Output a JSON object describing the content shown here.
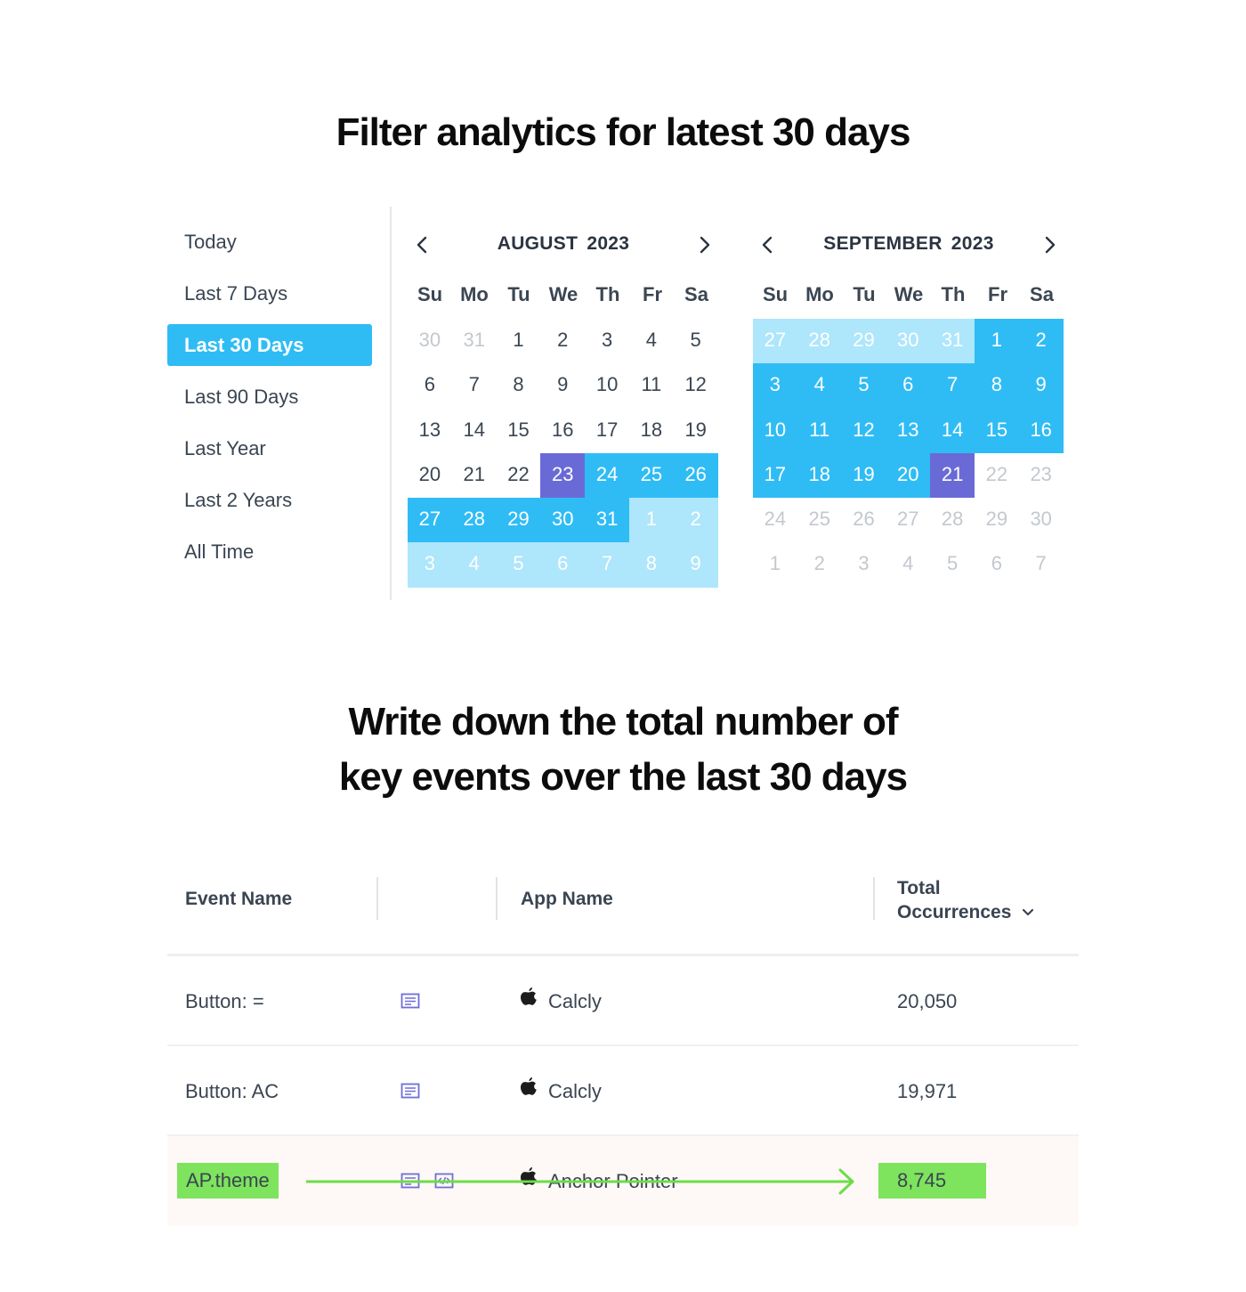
{
  "headings": {
    "top": "Filter analytics for latest 30 days",
    "bottom_line1": "Write down the total number of",
    "bottom_line2": "key events over the last 30 days"
  },
  "presets": [
    {
      "label": "Today",
      "active": false
    },
    {
      "label": "Last 7 Days",
      "active": false
    },
    {
      "label": "Last 30 Days",
      "active": true
    },
    {
      "label": "Last 90 Days",
      "active": false
    },
    {
      "label": "Last Year",
      "active": false
    },
    {
      "label": "Last 2 Years",
      "active": false
    },
    {
      "label": "All Time",
      "active": false
    }
  ],
  "weekdays": [
    "Su",
    "Mo",
    "Tu",
    "We",
    "Th",
    "Fr",
    "Sa"
  ],
  "calendars": [
    {
      "title": "AUGUST  2023",
      "days": [
        [
          "30",
          "muted"
        ],
        [
          "31",
          "muted"
        ],
        [
          "1",
          ""
        ],
        [
          "2",
          ""
        ],
        [
          "3",
          ""
        ],
        [
          "4",
          ""
        ],
        [
          "5",
          ""
        ],
        [
          "6",
          ""
        ],
        [
          "7",
          ""
        ],
        [
          "8",
          ""
        ],
        [
          "9",
          ""
        ],
        [
          "10",
          ""
        ],
        [
          "11",
          ""
        ],
        [
          "12",
          ""
        ],
        [
          "13",
          ""
        ],
        [
          "14",
          ""
        ],
        [
          "15",
          ""
        ],
        [
          "16",
          ""
        ],
        [
          "17",
          ""
        ],
        [
          "18",
          ""
        ],
        [
          "19",
          ""
        ],
        [
          "20",
          ""
        ],
        [
          "21",
          ""
        ],
        [
          "22",
          ""
        ],
        [
          "23",
          "edge"
        ],
        [
          "24",
          "sel"
        ],
        [
          "25",
          "sel"
        ],
        [
          "26",
          "sel"
        ],
        [
          "27",
          "sel"
        ],
        [
          "28",
          "sel"
        ],
        [
          "29",
          "sel"
        ],
        [
          "30",
          "sel"
        ],
        [
          "31",
          "sel"
        ],
        [
          "1",
          "light"
        ],
        [
          "2",
          "light"
        ],
        [
          "3",
          "light"
        ],
        [
          "4",
          "light"
        ],
        [
          "5",
          "light"
        ],
        [
          "6",
          "light"
        ],
        [
          "7",
          "light"
        ],
        [
          "8",
          "light"
        ],
        [
          "9",
          "light"
        ]
      ]
    },
    {
      "title": "SEPTEMBER  2023",
      "days": [
        [
          "27",
          "light"
        ],
        [
          "28",
          "light"
        ],
        [
          "29",
          "light"
        ],
        [
          "30",
          "light"
        ],
        [
          "31",
          "light"
        ],
        [
          "1",
          "sel"
        ],
        [
          "2",
          "sel"
        ],
        [
          "3",
          "sel"
        ],
        [
          "4",
          "sel"
        ],
        [
          "5",
          "sel"
        ],
        [
          "6",
          "sel"
        ],
        [
          "7",
          "sel"
        ],
        [
          "8",
          "sel"
        ],
        [
          "9",
          "sel"
        ],
        [
          "10",
          "sel"
        ],
        [
          "11",
          "sel"
        ],
        [
          "12",
          "sel"
        ],
        [
          "13",
          "sel"
        ],
        [
          "14",
          "sel"
        ],
        [
          "15",
          "sel"
        ],
        [
          "16",
          "sel"
        ],
        [
          "17",
          "sel"
        ],
        [
          "18",
          "sel"
        ],
        [
          "19",
          "sel"
        ],
        [
          "20",
          "sel"
        ],
        [
          "21",
          "edge"
        ],
        [
          "22",
          "muted"
        ],
        [
          "23",
          "muted"
        ],
        [
          "24",
          "muted"
        ],
        [
          "25",
          "muted"
        ],
        [
          "26",
          "muted"
        ],
        [
          "27",
          "muted"
        ],
        [
          "28",
          "muted"
        ],
        [
          "29",
          "muted"
        ],
        [
          "30",
          "muted"
        ],
        [
          "1",
          "muted"
        ],
        [
          "2",
          "muted"
        ],
        [
          "3",
          "muted"
        ],
        [
          "4",
          "muted"
        ],
        [
          "5",
          "muted"
        ],
        [
          "6",
          "muted"
        ],
        [
          "7",
          "muted"
        ]
      ]
    }
  ],
  "colors": {
    "selected": "#2fbcf5",
    "range_edge": "#6a6ad6",
    "out_of_month_selected": "#aee6fb",
    "highlight": "#7ee35d"
  },
  "table": {
    "headers": {
      "event_name": "Event Name",
      "app_name": "App Name",
      "total_line1": "Total",
      "total_line2": "Occurrences"
    },
    "rows": [
      {
        "event": "Button: =",
        "app": "Calcly",
        "total": "20,050"
      },
      {
        "event": "Button: AC",
        "app": "Calcly",
        "total": "19,971"
      },
      {
        "event": "AP.theme",
        "app": "Anchor Pointer",
        "total": "8,745"
      }
    ]
  }
}
